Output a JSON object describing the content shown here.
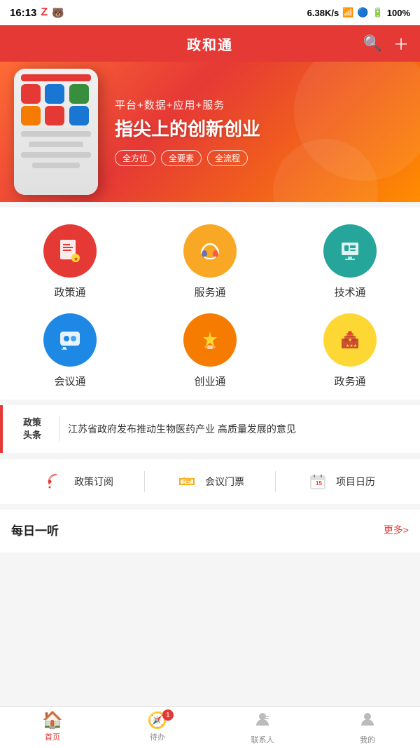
{
  "statusBar": {
    "time": "16:13",
    "networkSpeed": "6.38K/s",
    "battery": "100%"
  },
  "header": {
    "title": "政和通",
    "searchLabel": "搜索",
    "addLabel": "添加"
  },
  "banner": {
    "subtitle": "平台+数据+应用+服务",
    "title": "指尖上的创新创业",
    "tags": [
      "全方位",
      "全要素",
      "全流程"
    ]
  },
  "iconGrid": {
    "items": [
      {
        "id": "policy",
        "label": "政策通",
        "emoji": "📋",
        "colorClass": "red"
      },
      {
        "id": "service",
        "label": "服务通",
        "emoji": "🤝",
        "colorClass": "yellow"
      },
      {
        "id": "tech",
        "label": "技术通",
        "emoji": "💡",
        "colorClass": "teal"
      },
      {
        "id": "meeting",
        "label": "会议通",
        "emoji": "💬",
        "colorClass": "blue"
      },
      {
        "id": "startup",
        "label": "创业通",
        "emoji": "🏆",
        "colorClass": "orange"
      },
      {
        "id": "affairs",
        "label": "政务通",
        "emoji": "⭐",
        "colorClass": "gold"
      }
    ]
  },
  "news": {
    "tag": "政策\n头条",
    "text": "江苏省政府发布推动生物医药产业 高质量发展的意见"
  },
  "quickLinks": [
    {
      "id": "subscribe",
      "icon": "📡",
      "label": "政策订阅"
    },
    {
      "id": "ticket",
      "icon": "🎫",
      "label": "会议门票"
    },
    {
      "id": "calendar",
      "icon": "📅",
      "label": "项目日历"
    }
  ],
  "daily": {
    "title": "每日一听",
    "moreLabel": "更多>"
  },
  "bottomNav": {
    "items": [
      {
        "id": "home",
        "icon": "🏠",
        "label": "首页",
        "active": true,
        "badge": null
      },
      {
        "id": "todo",
        "icon": "🧭",
        "label": "待办",
        "active": false,
        "badge": "1"
      },
      {
        "id": "contacts",
        "icon": "👤",
        "label": "联系人",
        "active": false,
        "badge": null
      },
      {
        "id": "mine",
        "icon": "👤",
        "label": "我的",
        "active": false,
        "badge": null
      }
    ]
  }
}
